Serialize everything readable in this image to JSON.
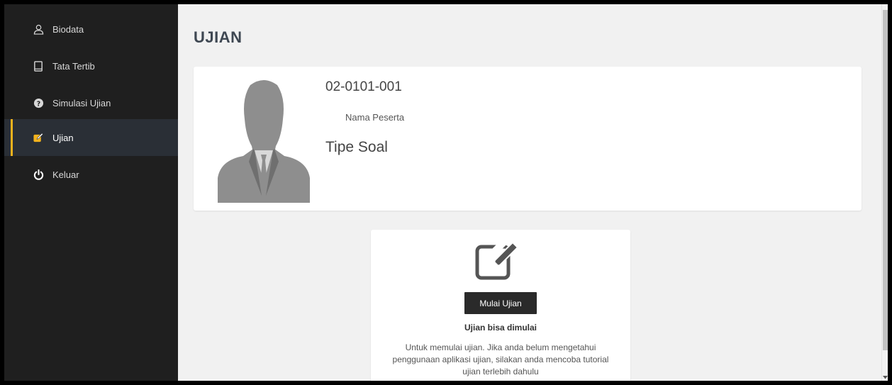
{
  "sidebar": {
    "items": [
      {
        "label": "Biodata",
        "icon": "user-icon"
      },
      {
        "label": "Tata Tertib",
        "icon": "book-icon"
      },
      {
        "label": "Simulasi Ujian",
        "icon": "question-circle-icon"
      },
      {
        "label": "Ujian",
        "icon": "edit-icon",
        "active": true
      },
      {
        "label": "Keluar",
        "icon": "power-icon"
      }
    ],
    "active_color": "#f2b21d"
  },
  "main": {
    "title": "UJIAN",
    "profile": {
      "id": "02-0101-001",
      "name_label": "Nama Peserta",
      "type_label": "Tipe Soal"
    },
    "exam": {
      "start_label": "Mulai Ujian",
      "status": "Ujian bisa dimulai",
      "description": "Untuk memulai ujian. Jika anda belum mengetahui penggunaan aplikasi ujian, silakan anda mencoba tutorial ujian terlebih dahulu"
    }
  }
}
